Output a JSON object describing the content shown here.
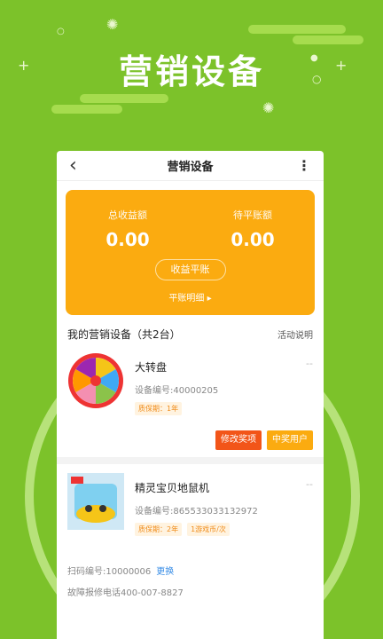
{
  "promo": {
    "title": "营销设备"
  },
  "nav": {
    "back": "‹",
    "title": "营销设备",
    "more": "⋮"
  },
  "income": {
    "total_label": "总收益额",
    "total_value": "0.00",
    "pending_label": "待平账额",
    "pending_value": "0.00",
    "settle_button": "收益平账",
    "detail_link": "平账明细 ▸"
  },
  "devices_section": {
    "title": "我的营销设备（共2台）",
    "help": "活动说明"
  },
  "devices": [
    {
      "name": "大转盘",
      "dash": "--",
      "code": "设备编号:40000205",
      "tags": [
        "质保期：1年"
      ],
      "actions": [
        "修改奖项",
        "中奖用户"
      ]
    },
    {
      "name": "精灵宝贝地鼠机",
      "dash": "--",
      "code": "设备编号:865533033132972",
      "tags": [
        "质保期：2年",
        "1游戏币/次"
      ],
      "scan_code": "扫码编号:10000006",
      "change": "更换",
      "repair": "故障报修电话400-007-8827"
    }
  ],
  "colors": {
    "bg": "#7cc22a",
    "card": "#fbab10",
    "red": "#f25519"
  }
}
